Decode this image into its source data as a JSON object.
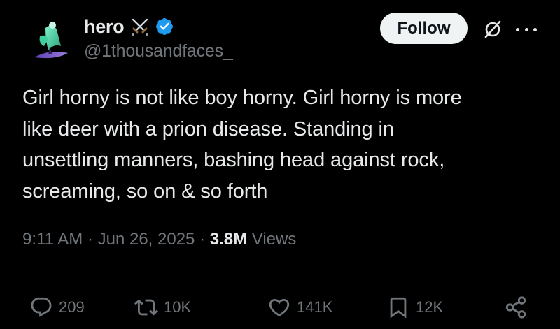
{
  "author": {
    "display_name": "hero",
    "handle": "@1thousandfaces_",
    "badges": [
      "crossed-swords-icon",
      "verified-icon"
    ],
    "verified_color": "#1d9bf0"
  },
  "header": {
    "follow_label": "Follow"
  },
  "tweet": {
    "text": "Girl horny is not like boy horny. Girl horny is more\nlike deer with a prion disease. Standing in\nunsettling manners, bashing head against rock,\nscreaming, so on & so forth"
  },
  "meta": {
    "time": "9:11 AM",
    "separator": " · ",
    "date": "Jun 26, 2025",
    "views_count": "3.8M",
    "views_label": " Views"
  },
  "actions": {
    "replies": "209",
    "reposts": "10K",
    "likes": "141K",
    "bookmarks": "12K"
  }
}
